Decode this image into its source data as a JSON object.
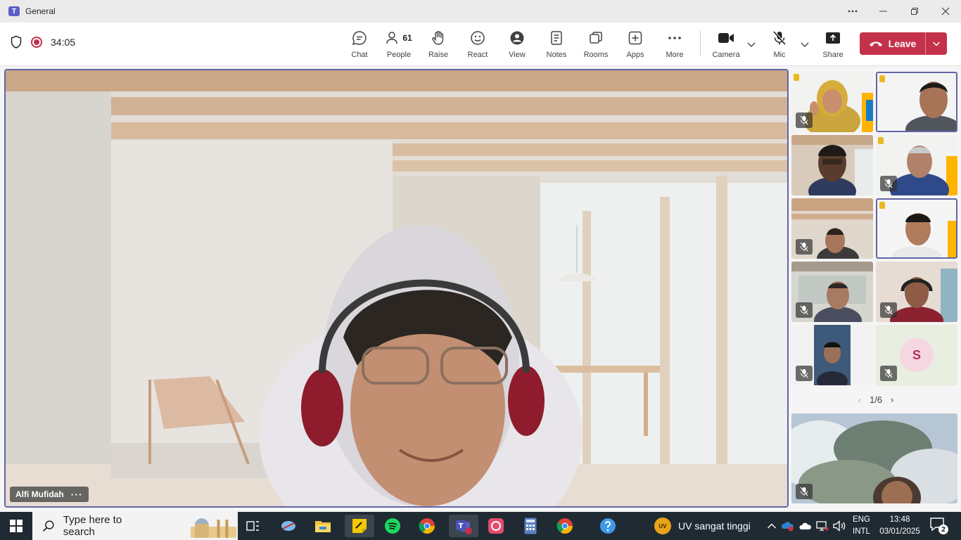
{
  "window": {
    "title": "General",
    "app_logo": "T",
    "controls": [
      "more-icon",
      "minimize-icon",
      "restore-icon",
      "close-icon"
    ]
  },
  "toolbar": {
    "timer": "34:05",
    "people_count": "61",
    "buttons": {
      "chat": "Chat",
      "people": "People",
      "raise": "Raise",
      "react": "React",
      "view": "View",
      "notes": "Notes",
      "rooms": "Rooms",
      "apps": "Apps",
      "more": "More",
      "camera": "Camera",
      "mic": "Mic",
      "share": "Share"
    },
    "leave_label": "Leave"
  },
  "stage": {
    "main_participant": "Alfi Mufidah",
    "main_options": "···",
    "avatar_initial": "S",
    "pager": {
      "current": "1/6",
      "prev": "‹",
      "next": "›"
    }
  },
  "taskbar": {
    "search_placeholder": "Type here to search",
    "weather_badge": "UV",
    "weather_text": "UV sangat tinggi",
    "lang_line1": "ENG",
    "lang_line2": "INTL",
    "time": "13:48",
    "date": "03/01/2025",
    "notification_count": "2"
  },
  "colors": {
    "accent": "#6264a7",
    "leave": "#c4314b",
    "taskbar": "#1f2a33"
  }
}
